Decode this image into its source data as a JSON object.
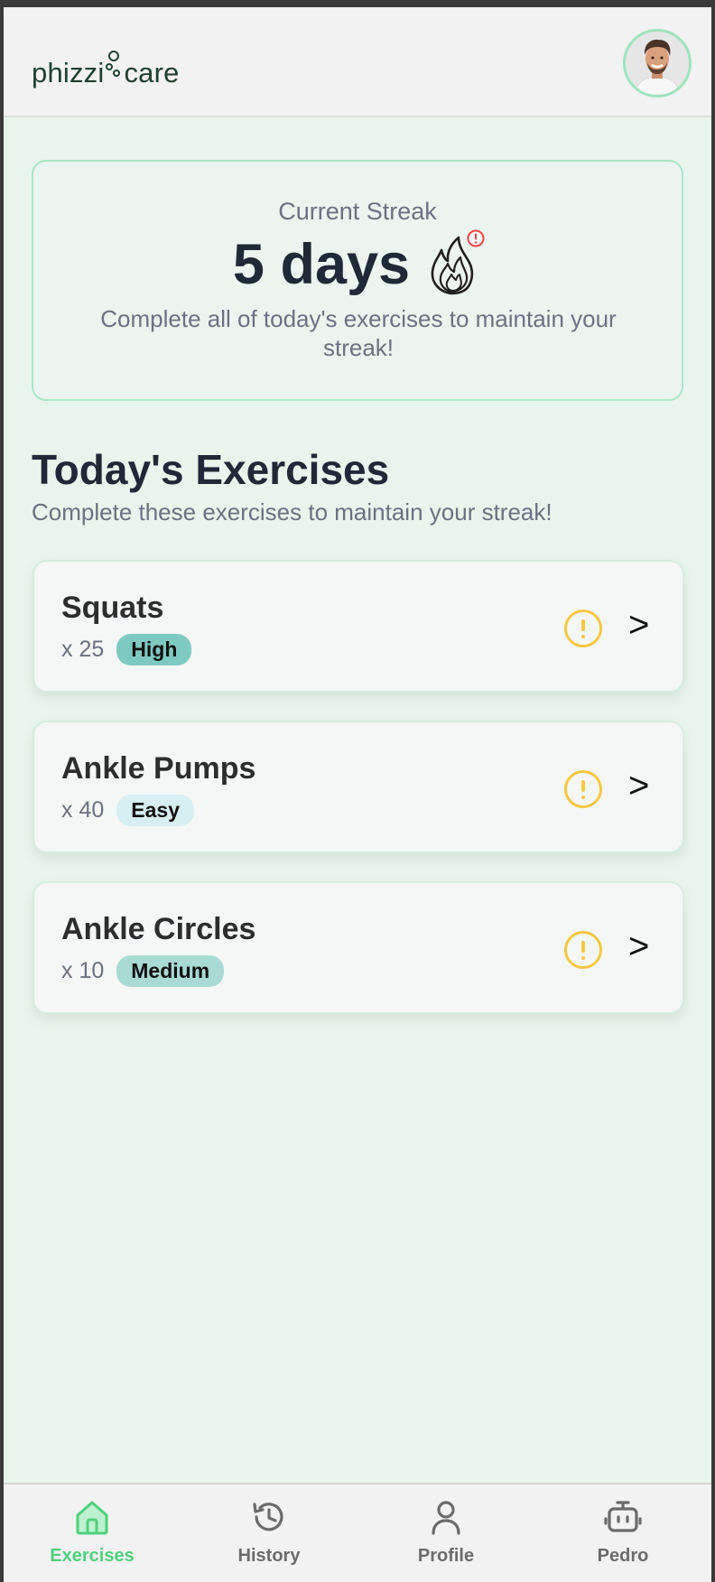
{
  "header": {
    "logo_left": "phizzi",
    "logo_right": "care"
  },
  "streak": {
    "label": "Current Streak",
    "value": "5 days",
    "message": "Complete all of today's exercises to maintain your streak!",
    "icon": "flame-icon",
    "alert_icon": "alert-circle-icon",
    "alert_color": "#ef4444"
  },
  "section": {
    "title": "Today's Exercises",
    "subtitle": "Complete these exercises to maintain your streak!"
  },
  "exercises": [
    {
      "name": "Squats",
      "count": "x 25",
      "difficulty": "High",
      "badge_color": "#7ec9c0"
    },
    {
      "name": "Ankle Pumps",
      "count": "x 40",
      "difficulty": "Easy",
      "badge_color": "#d7eef2"
    },
    {
      "name": "Ankle Circles",
      "count": "x 10",
      "difficulty": "Medium",
      "badge_color": "#a9dad4"
    }
  ],
  "exercise_actions": {
    "chevron": ">",
    "warning_icon": "warning-circle-icon",
    "warning_color": "#f5c842"
  },
  "nav": {
    "items": [
      {
        "label": "Exercises",
        "icon": "home-icon",
        "active": true
      },
      {
        "label": "History",
        "icon": "history-icon",
        "active": false
      },
      {
        "label": "Profile",
        "icon": "user-icon",
        "active": false
      },
      {
        "label": "Pedro",
        "icon": "robot-icon",
        "active": false
      }
    ],
    "active_color": "#4fd07d",
    "inactive_color": "#6b6b6b"
  }
}
